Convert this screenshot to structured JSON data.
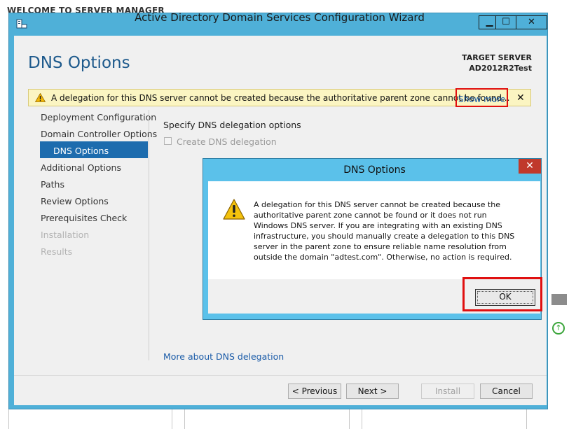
{
  "background": {
    "title": "WELCOME TO SERVER MANAGER"
  },
  "wizard": {
    "title": "Active Directory Domain Services Configuration Wizard",
    "page_title": "DNS Options",
    "target_server_label": "TARGET SERVER",
    "target_server_name": "AD2012R2Test",
    "warning_text": "A delegation for this DNS server cannot be created because the authoritative parent zone cannot be found...",
    "show_more": "Show more",
    "close_glyph": "✕",
    "nav": [
      {
        "label": "Deployment Configuration",
        "state": "enabled"
      },
      {
        "label": "Domain Controller Options",
        "state": "enabled"
      },
      {
        "label": "DNS Options",
        "state": "selected"
      },
      {
        "label": "Additional Options",
        "state": "enabled"
      },
      {
        "label": "Paths",
        "state": "enabled"
      },
      {
        "label": "Review Options",
        "state": "enabled"
      },
      {
        "label": "Prerequisites Check",
        "state": "enabled"
      },
      {
        "label": "Installation",
        "state": "disabled"
      },
      {
        "label": "Results",
        "state": "disabled"
      }
    ],
    "specify_label": "Specify DNS delegation options",
    "create_delegation_label": "Create DNS delegation",
    "create_delegation_checked": false,
    "more_link": "More about DNS delegation",
    "buttons": {
      "previous": "< Previous",
      "next": "Next >",
      "install": "Install",
      "cancel": "Cancel"
    }
  },
  "dialog": {
    "title": "DNS Options",
    "message": "A delegation for this DNS server cannot be created because the authoritative parent zone cannot be found or it does not run Windows DNS server. If you are integrating with an existing DNS infrastructure, you should manually create a delegation to this DNS server in the parent zone to ensure reliable name resolution from outside the domain \"adtest.com\". Otherwise, no action is required.",
    "ok": "OK",
    "close_glyph": "✕"
  },
  "colors": {
    "title_bar": "#4fb0d8",
    "dialog_title_bar": "#5bc1ea",
    "accent": "#1e5a8c",
    "selected_nav": "#1d6cae",
    "highlight_red": "#e01010",
    "warning_bar": "#fbf5c2"
  },
  "icons": [
    "server-manager-app-icon",
    "minimize-icon",
    "maximize-icon",
    "close-icon",
    "warning-icon"
  ]
}
